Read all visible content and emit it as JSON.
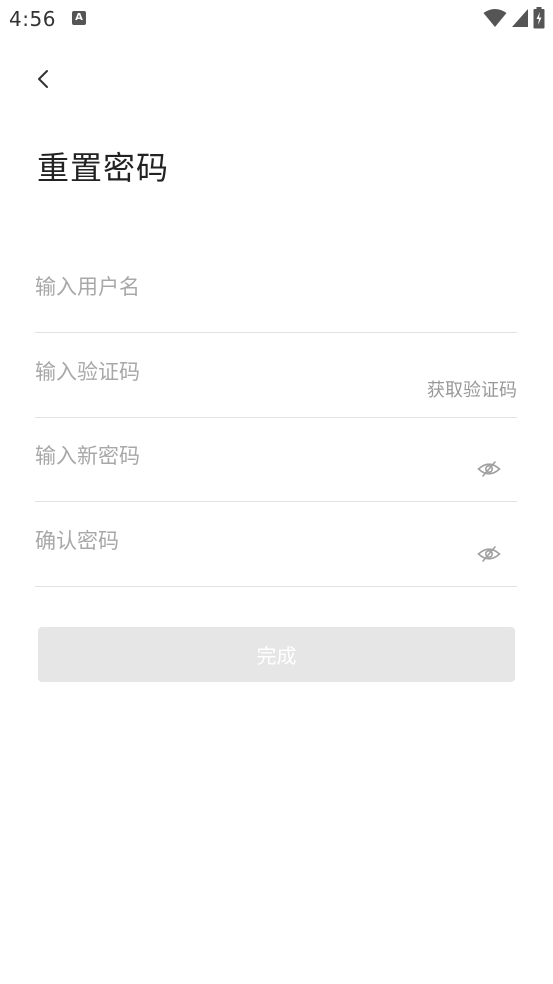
{
  "status_bar": {
    "time": "4:56",
    "app_icon_letter": "A",
    "icons": [
      "wifi-icon",
      "signal-icon",
      "battery-charging-icon"
    ]
  },
  "header": {
    "back_icon": "chevron-left-icon",
    "title": "重置密码"
  },
  "form": {
    "username": {
      "placeholder": "输入用户名",
      "value": ""
    },
    "code": {
      "placeholder": "输入验证码",
      "value": "",
      "get_code_label": "获取验证码"
    },
    "new_password": {
      "placeholder": "输入新密码",
      "value": "",
      "toggle_icon": "eye-off-icon"
    },
    "confirm_password": {
      "placeholder": "确认密码",
      "value": "",
      "toggle_icon": "eye-off-icon"
    },
    "submit_label": "完成"
  },
  "colors": {
    "placeholder": "#a8a8a8",
    "divider": "#e2e2e2",
    "button_disabled_bg": "#e6e6e6",
    "button_text": "#ffffff",
    "link_gray": "#999999"
  }
}
